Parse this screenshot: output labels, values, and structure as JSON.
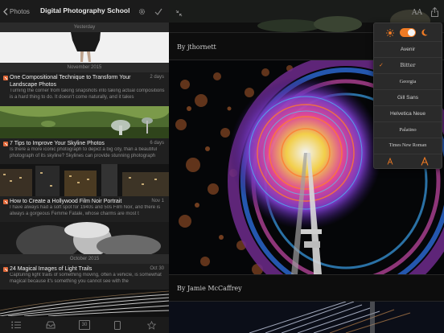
{
  "sidebar": {
    "back_label": "Photos",
    "title": "Digital Photography School",
    "dividers": [
      "Yesterday",
      "November 2015",
      "October 2015"
    ],
    "articles": [
      {
        "title": "One Compositional Technique to Transform Your Landscape Photos",
        "date": "2 days",
        "excerpt": "Turning the corner from taking snapshots into taking actual compositions is a hard thing to do. It doesn't come naturally, and it takes"
      },
      {
        "title": "7 Tips to Improve Your Skyline Photos",
        "date": "6 days",
        "excerpt": "Is there a more iconic photograph to depict a big city, than a beautiful photograph of its skyline? Skylines can provide stunning photograph"
      },
      {
        "title": "How to Create a Hollywood Film Noir Portrait",
        "date": "Nov 1",
        "excerpt": "I have always had a soft spot for 1940s and 50s Film Noir, and there is always a gorgeous Femme Fatale, whose charms are most t"
      },
      {
        "title": "24 Magical Images of Light Trails",
        "date": "Oct 30",
        "excerpt": "Capturing light trails of something moving, often a vehicle, is somewhat magical because it's something you cannot see with the"
      }
    ],
    "tab_calendar_number": "30"
  },
  "reader": {
    "byline_1": "By jthornett",
    "byline_2": "By Jamie McCaffrey",
    "text_size_label": "AA"
  },
  "font_popover": {
    "fonts": [
      "Avenir",
      "Bitter",
      "Georgia",
      "Gill Sans",
      "Helvetica Neue",
      "Palatino",
      "Times New Roman"
    ],
    "selected": "Bitter",
    "theme_toggle": "dark",
    "accent_color": "#f07b24"
  }
}
